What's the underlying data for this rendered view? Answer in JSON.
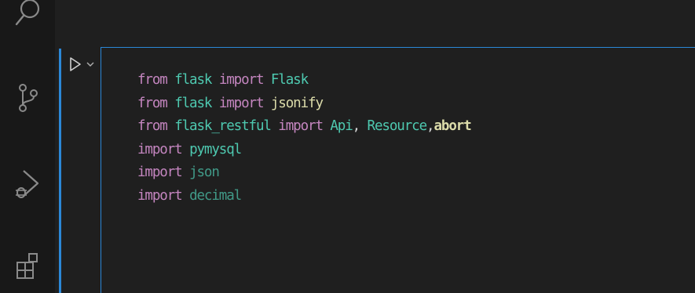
{
  "activity_bar": {
    "icons": [
      "search-icon",
      "source-control-icon",
      "run-debug-icon",
      "extensions-icon"
    ]
  },
  "cell": {
    "toolbar": {
      "run_icon": "run-cell-icon",
      "collapse_icon": "chevron-down-icon"
    },
    "lines": [
      {
        "tokens": [
          {
            "text": "from",
            "kind": "kw"
          },
          {
            "text": " ",
            "kind": "plain"
          },
          {
            "text": "flask",
            "kind": "mod"
          },
          {
            "text": " ",
            "kind": "plain"
          },
          {
            "text": "import",
            "kind": "kw"
          },
          {
            "text": " ",
            "kind": "plain"
          },
          {
            "text": "Flask",
            "kind": "mod"
          }
        ]
      },
      {
        "tokens": [
          {
            "text": "from",
            "kind": "kw"
          },
          {
            "text": " ",
            "kind": "plain"
          },
          {
            "text": "flask",
            "kind": "mod"
          },
          {
            "text": " ",
            "kind": "plain"
          },
          {
            "text": "import",
            "kind": "kw"
          },
          {
            "text": " ",
            "kind": "plain"
          },
          {
            "text": "jsonify",
            "kind": "fn"
          }
        ]
      },
      {
        "tokens": [
          {
            "text": "from",
            "kind": "kw"
          },
          {
            "text": " ",
            "kind": "plain"
          },
          {
            "text": "flask_restful",
            "kind": "mod"
          },
          {
            "text": " ",
            "kind": "plain"
          },
          {
            "text": "import",
            "kind": "kw"
          },
          {
            "text": " ",
            "kind": "plain"
          },
          {
            "text": "Api",
            "kind": "mod"
          },
          {
            "text": ", ",
            "kind": "plain"
          },
          {
            "text": "Resource",
            "kind": "mod"
          },
          {
            "text": ",",
            "kind": "plain"
          },
          {
            "text": "abort",
            "kind": "abort"
          }
        ]
      },
      {
        "tokens": [
          {
            "text": "import",
            "kind": "kw"
          },
          {
            "text": " ",
            "kind": "plain"
          },
          {
            "text": "pymysql",
            "kind": "mod"
          }
        ]
      },
      {
        "tokens": [
          {
            "text": "import",
            "kind": "kw"
          },
          {
            "text": " ",
            "kind": "plain"
          },
          {
            "text": "json",
            "kind": "dim-mod"
          }
        ]
      },
      {
        "tokens": [
          {
            "text": "import",
            "kind": "kw"
          },
          {
            "text": " ",
            "kind": "plain"
          },
          {
            "text": "decimal",
            "kind": "dim-mod"
          }
        ]
      }
    ]
  },
  "colors": {
    "accent": "#2b88d8",
    "keyword": "#c586c0",
    "module": "#4ec9b0",
    "function": "#dcdcaa",
    "background": "#1f1f1f"
  }
}
